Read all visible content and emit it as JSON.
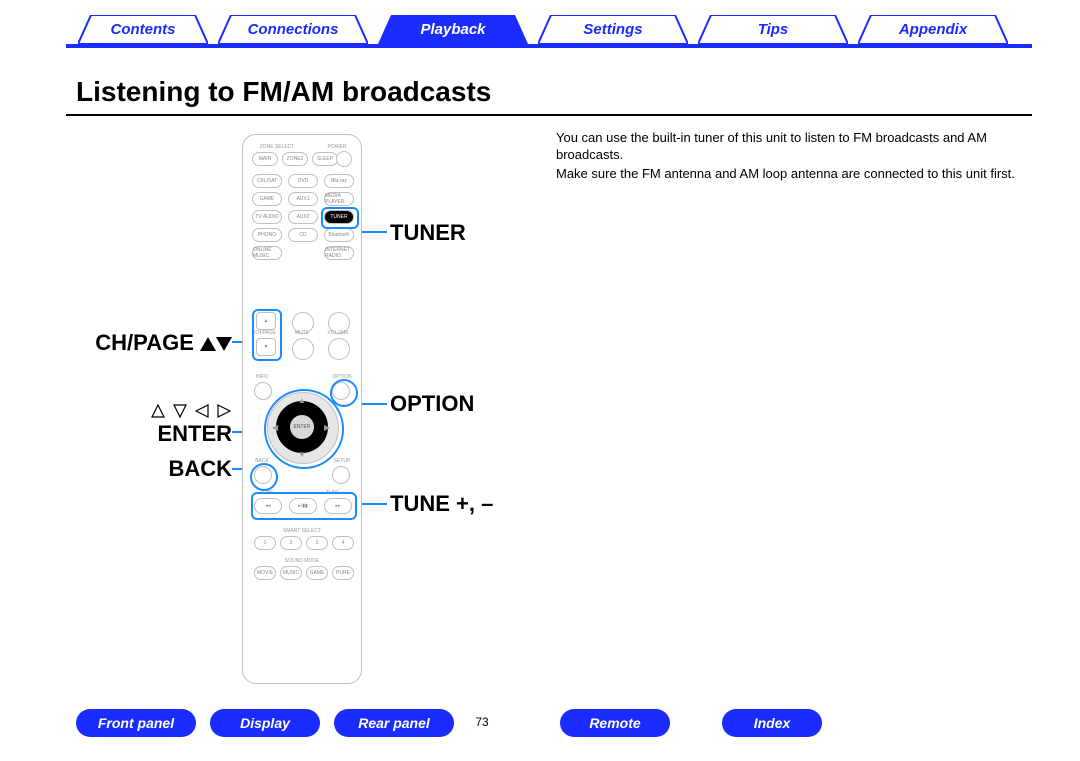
{
  "nav": {
    "tabs": [
      {
        "label": "Contents",
        "active": false
      },
      {
        "label": "Connections",
        "active": false
      },
      {
        "label": "Playback",
        "active": true
      },
      {
        "label": "Settings",
        "active": false
      },
      {
        "label": "Tips",
        "active": false
      },
      {
        "label": "Appendix",
        "active": false
      }
    ]
  },
  "heading": "Listening to FM/AM broadcasts",
  "body": {
    "p1": "You can use the built-in tuner of this unit to listen to FM broadcasts and AM broadcasts.",
    "p2": "Make sure the FM antenna and AM loop antenna are connected to this unit first."
  },
  "callouts": {
    "tuner": "TUNER",
    "chpage": "CH/PAGE",
    "option": "OPTION",
    "enter": "ENTER",
    "back": "BACK",
    "tune": "TUNE +, –"
  },
  "remote_buttons": {
    "row1": [
      "MAIN",
      "ZONE2",
      "SLEEP"
    ],
    "row2": [
      "CBL/SAT",
      "DVD",
      "Blu-ray"
    ],
    "row3": [
      "GAME",
      "AUX1",
      "MEDIA PLAYER"
    ],
    "row4": [
      "TV AUDIO",
      "AUX2",
      "TUNER"
    ],
    "row5": [
      "PHONO",
      "CD",
      "Bluetooth"
    ],
    "row6": [
      "ONLINE MUSIC",
      "",
      "INTERNET RADIO"
    ],
    "chpage": "CH/PAGE",
    "mute": "MUTE",
    "volume": "VOLUME",
    "info": "INFO",
    "option": "OPTION",
    "back": "BACK",
    "setup": "SETUP",
    "enter": "ENTER",
    "tune_minus": "TUNE –",
    "tune_plus": "TUNE +",
    "smart": "SMART SELECT",
    "sound": "SOUND MODE",
    "modes": [
      "MOVIE",
      "MUSIC",
      "GAME",
      "PURE"
    ],
    "zone": "ZONE SELECT",
    "power": "POWER"
  },
  "footer": {
    "buttons": [
      {
        "label": "Front panel"
      },
      {
        "label": "Display"
      },
      {
        "label": "Rear panel"
      },
      {
        "label": "Remote"
      },
      {
        "label": "Index"
      }
    ],
    "page": "73"
  },
  "colors": {
    "brand": "#1a2cff",
    "highlight": "#1a8cff"
  }
}
